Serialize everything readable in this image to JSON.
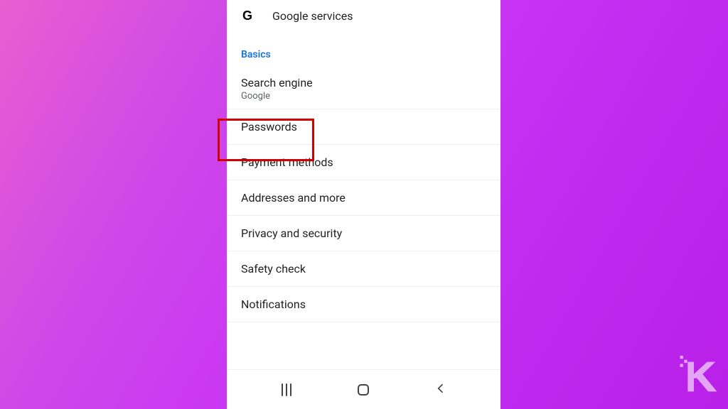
{
  "google_services": {
    "icon": "G",
    "label": "Google services"
  },
  "section_header": "Basics",
  "settings": {
    "search_engine": {
      "title": "Search engine",
      "value": "Google"
    },
    "passwords": {
      "title": "Passwords"
    },
    "payment_methods": {
      "title": "Payment methods"
    },
    "addresses": {
      "title": "Addresses and more"
    },
    "privacy_security": {
      "title": "Privacy and security"
    },
    "safety_check": {
      "title": "Safety check"
    },
    "notifications": {
      "title": "Notifications"
    }
  }
}
